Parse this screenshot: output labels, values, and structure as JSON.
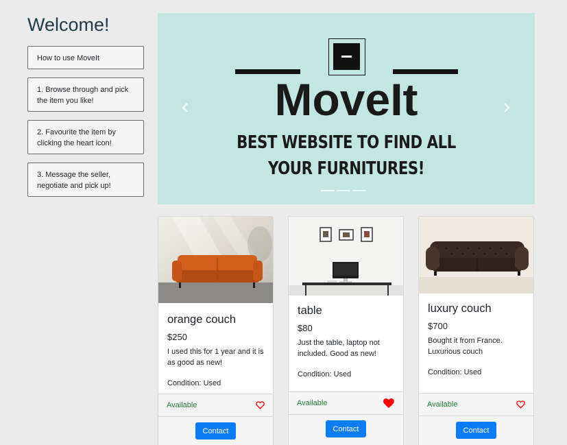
{
  "sidebar": {
    "title": "Welcome!",
    "steps": [
      "How to use MoveIt",
      "1. Browse through and pick the item you like!",
      "2. Favourite the item by clicking the heart icon!",
      "3. Message the seller, negotiate and pick up!"
    ]
  },
  "carousel": {
    "brand": "MoveIt",
    "tagline_line1": "BEST WEBSITE TO FIND ALL",
    "tagline_line2": "YOUR FURNITURES!",
    "background": "#c3e6e0",
    "slides": 3,
    "active_slide": 1
  },
  "listings": [
    {
      "title": "orange couch",
      "price": "$250",
      "description": "I used this for 1 year and it is as good as new!",
      "condition": "Condition: Used",
      "status": "Available",
      "favourited": false,
      "button": "Contact"
    },
    {
      "title": "table",
      "price": "$80",
      "description": "Just the table, laptop not included. Good as new!",
      "condition": "Condition: Used",
      "status": "Available",
      "favourited": true,
      "button": "Contact"
    },
    {
      "title": "luxury couch",
      "price": "$700",
      "description": "Bought it from France. Luxurious couch",
      "condition": "Condition: Used",
      "status": "Available",
      "favourited": false,
      "button": "Contact"
    }
  ],
  "colors": {
    "accent": "#0d7cf2",
    "available": "#1e7e34",
    "heart": "#ff0000"
  }
}
